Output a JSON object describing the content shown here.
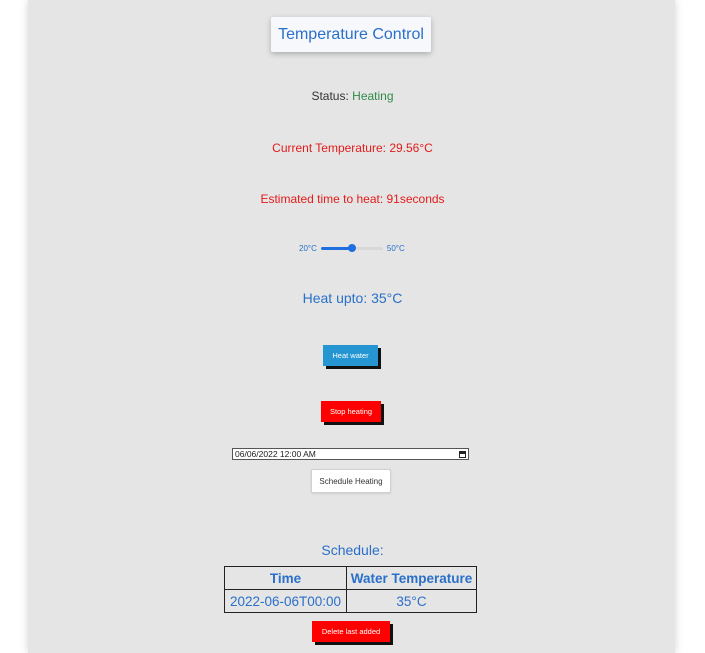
{
  "title": "Temperature Control",
  "status": {
    "label": "Status:",
    "value": "Heating",
    "value_color": "#2f8a4a"
  },
  "current_temperature": "Current Temperature: 29.56°C",
  "estimated_time": "Estimated time to heat: 91seconds",
  "slider": {
    "min_label": "20°C",
    "max_label": "50°C",
    "min": 20,
    "max": 50,
    "value": 35
  },
  "heat_upto": "Heat upto: 35°C",
  "buttons": {
    "heat": "Heat water",
    "stop": "Stop heating",
    "schedule": "Schedule Heating",
    "delete": "Delete last added"
  },
  "datetime_input": {
    "date_value": "06/06/2022 12:",
    "time_value": "00 AM"
  },
  "schedule": {
    "title": "Schedule:",
    "columns": [
      "Time",
      "Water Temperature"
    ],
    "rows": [
      {
        "time": "2022-06-06T00:00",
        "temperature": "35°C"
      }
    ]
  },
  "colors": {
    "accent_blue": "#2a6fc9",
    "alert_red": "#e31b1b",
    "heat_button": "#2596d1",
    "stop_button": "#ff0000",
    "panel_bg": "#e5e5e5"
  },
  "icons": {
    "calendar": "calendar-icon"
  }
}
